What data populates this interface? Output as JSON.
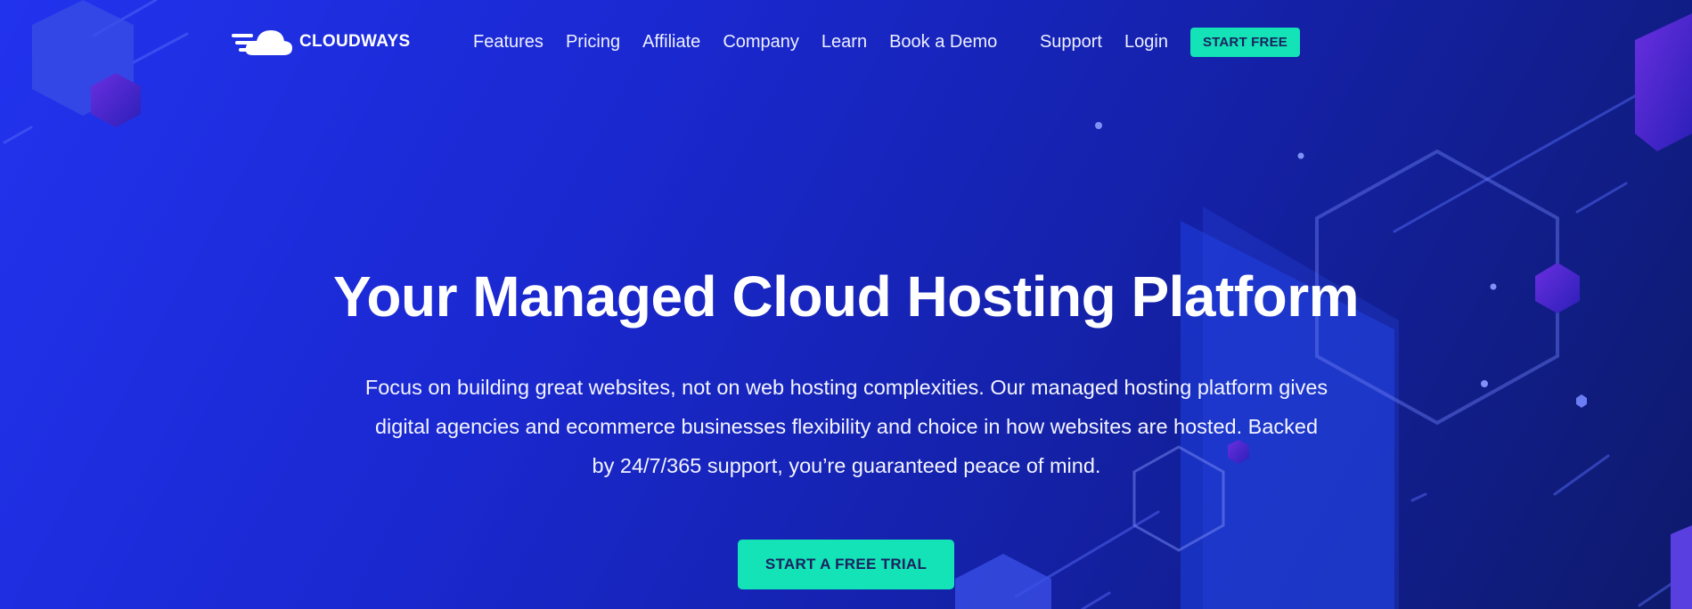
{
  "brand": {
    "name": "CLOUDWAYS",
    "logo_icon": "cloud-logo-icon"
  },
  "nav": {
    "items": [
      {
        "label": "Features"
      },
      {
        "label": "Pricing"
      },
      {
        "label": "Affiliate"
      },
      {
        "label": "Company"
      },
      {
        "label": "Learn"
      },
      {
        "label": "Book a Demo"
      }
    ],
    "support": "Support",
    "login": "Login",
    "start_free": "START FREE"
  },
  "hero": {
    "title": "Your Managed Cloud Hosting Platform",
    "line1": "Focus on building great websites, not on web hosting complexities. Our managed hosting platform gives",
    "line2": "digital agencies and ecommerce businesses flexibility and choice in how websites are hosted. Backed",
    "line3": "by 24/7/365 support, you’re guaranteed peace of mind.",
    "cta": "START A FREE TRIAL"
  },
  "colors": {
    "accent": "#13e3b6",
    "bg_start": "#2233ee",
    "bg_end": "#0e1a6b",
    "button_text": "#1b2260"
  }
}
